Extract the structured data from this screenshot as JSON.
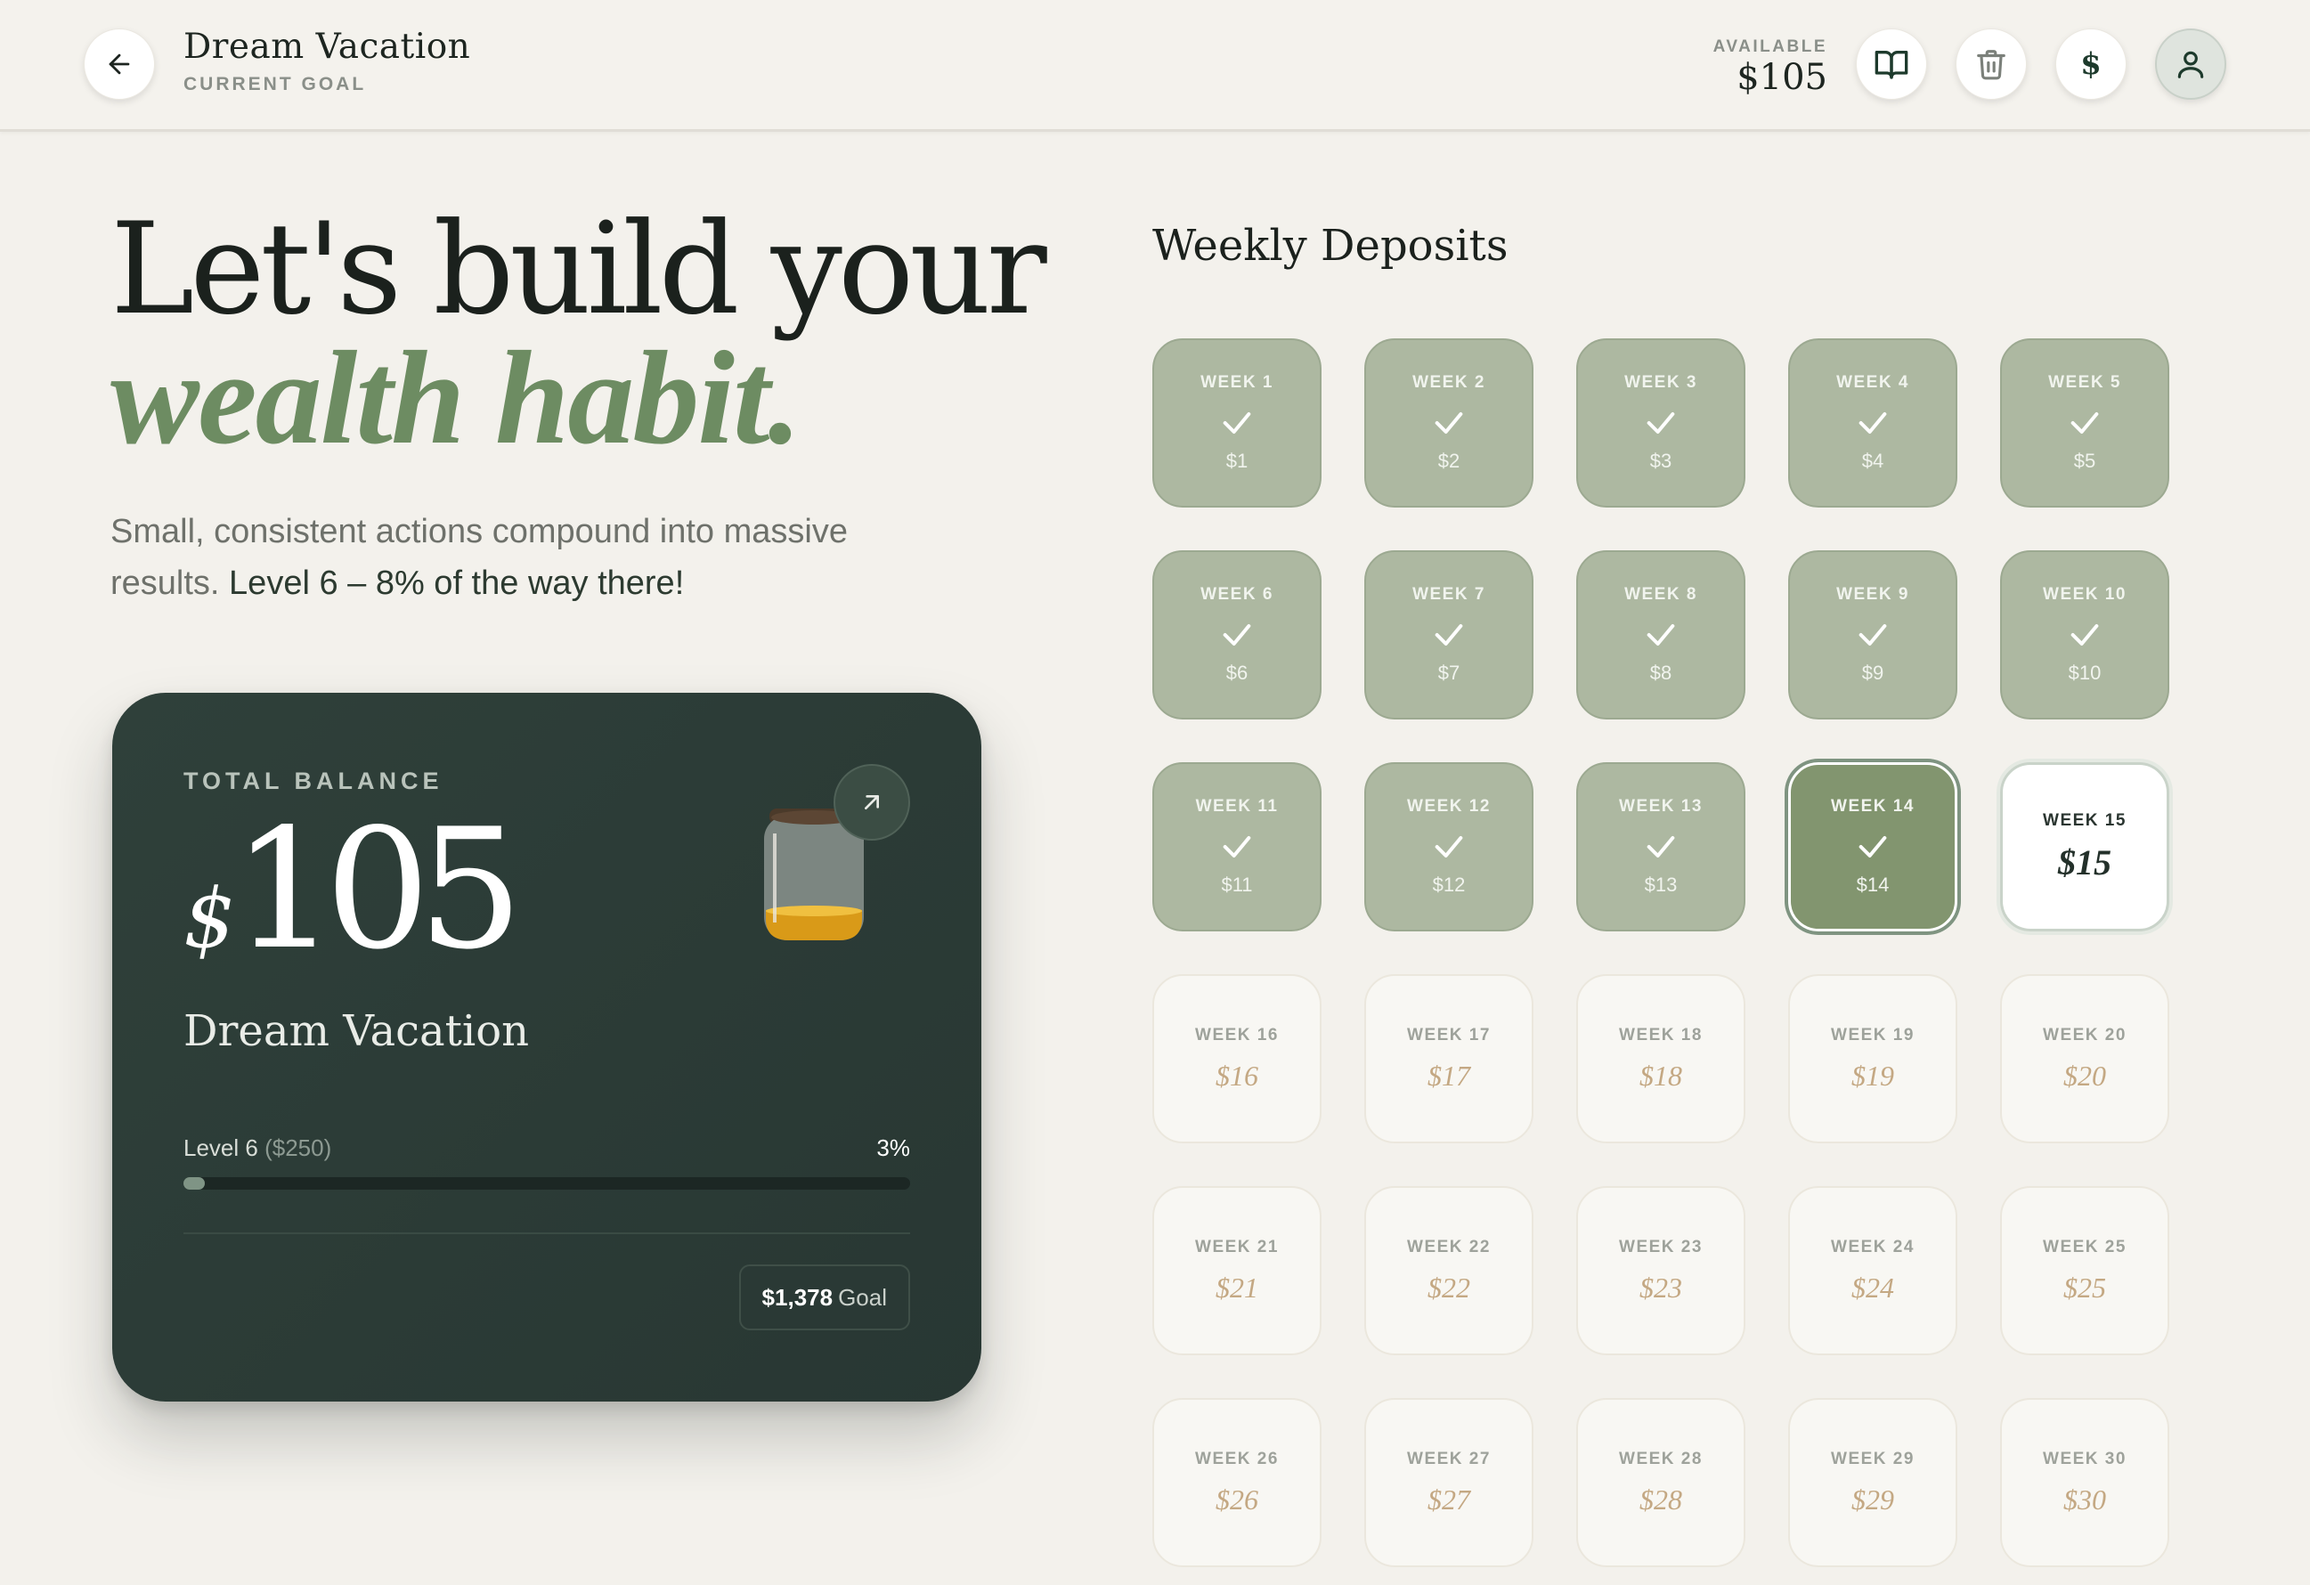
{
  "header": {
    "goal_title": "Dream Vacation",
    "goal_subtitle": "CURRENT GOAL",
    "available_label": "AVAILABLE",
    "available_value": "$105",
    "icons": [
      "back-arrow-icon",
      "book-icon",
      "trash-icon",
      "dollar-icon",
      "user-icon"
    ],
    "dollar_glyph": "$"
  },
  "hero": {
    "line1": "Let's build your",
    "line2": "wealth habit.",
    "text": "Small, consistent actions compound into massive results.",
    "text_strong": "Level 6 – 8% of the way there!"
  },
  "card": {
    "label": "TOTAL BALANCE",
    "currency": "$",
    "amount": "105",
    "goal_name": "Dream Vacation",
    "level_label": "Level 6",
    "level_target": "($250)",
    "level_percent": "3%",
    "progress_fraction": 0.03,
    "goal_amount": "$1,378",
    "goal_word": "Goal"
  },
  "deposits": {
    "title": "Weekly Deposits",
    "weeks": [
      {
        "label": "WEEK 1",
        "amount": "$1",
        "status": "done"
      },
      {
        "label": "WEEK 2",
        "amount": "$2",
        "status": "done"
      },
      {
        "label": "WEEK 3",
        "amount": "$3",
        "status": "done"
      },
      {
        "label": "WEEK 4",
        "amount": "$4",
        "status": "done"
      },
      {
        "label": "WEEK 5",
        "amount": "$5",
        "status": "done"
      },
      {
        "label": "WEEK 6",
        "amount": "$6",
        "status": "done"
      },
      {
        "label": "WEEK 7",
        "amount": "$7",
        "status": "done"
      },
      {
        "label": "WEEK 8",
        "amount": "$8",
        "status": "done"
      },
      {
        "label": "WEEK 9",
        "amount": "$9",
        "status": "done"
      },
      {
        "label": "WEEK 10",
        "amount": "$10",
        "status": "done"
      },
      {
        "label": "WEEK 11",
        "amount": "$11",
        "status": "done"
      },
      {
        "label": "WEEK 12",
        "amount": "$12",
        "status": "done"
      },
      {
        "label": "WEEK 13",
        "amount": "$13",
        "status": "done"
      },
      {
        "label": "WEEK 14",
        "amount": "$14",
        "status": "last"
      },
      {
        "label": "WEEK 15",
        "amount": "$15",
        "status": "current"
      },
      {
        "label": "WEEK 16",
        "amount": "$16",
        "status": "future"
      },
      {
        "label": "WEEK 17",
        "amount": "$17",
        "status": "future"
      },
      {
        "label": "WEEK 18",
        "amount": "$18",
        "status": "future"
      },
      {
        "label": "WEEK 19",
        "amount": "$19",
        "status": "future"
      },
      {
        "label": "WEEK 20",
        "amount": "$20",
        "status": "future"
      },
      {
        "label": "WEEK 21",
        "amount": "$21",
        "status": "future"
      },
      {
        "label": "WEEK 22",
        "amount": "$22",
        "status": "future"
      },
      {
        "label": "WEEK 23",
        "amount": "$23",
        "status": "future"
      },
      {
        "label": "WEEK 24",
        "amount": "$24",
        "status": "future"
      },
      {
        "label": "WEEK 25",
        "amount": "$25",
        "status": "future"
      },
      {
        "label": "WEEK 26",
        "amount": "$26",
        "status": "future"
      },
      {
        "label": "WEEK 27",
        "amount": "$27",
        "status": "future"
      },
      {
        "label": "WEEK 28",
        "amount": "$28",
        "status": "future"
      },
      {
        "label": "WEEK 29",
        "amount": "$29",
        "status": "future"
      },
      {
        "label": "WEEK 30",
        "amount": "$30",
        "status": "future"
      }
    ]
  },
  "colors": {
    "background": "#f3f1ec",
    "accent_green": "#6d8c62",
    "card_dark": "#2c3c37",
    "done_tile": "#adb8a1",
    "last_tile": "#82956f",
    "future_amount": "#c4a883"
  }
}
